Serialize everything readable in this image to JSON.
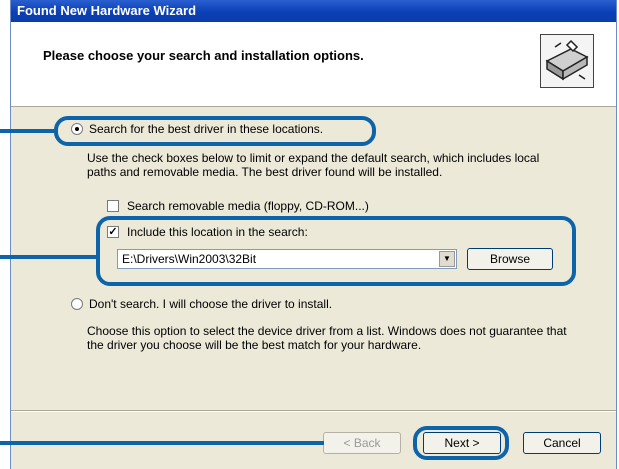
{
  "window": {
    "title": "Found New Hardware Wizard"
  },
  "header": {
    "title": "Please choose your search and installation options.",
    "icon": "hardware-icon"
  },
  "options": {
    "search_label": "Search for the best driver in these locations.",
    "search_desc_1": "Use the check boxes below to limit or expand the default search, which includes local",
    "search_desc_2": "paths and removable media. The best driver found will be installed.",
    "removable_label": "Search removable media (floppy, CD-ROM...)",
    "include_label": "Include this location in the search:",
    "location_value": "E:\\Drivers\\Win2003\\32Bit",
    "browse_label": "Browse",
    "dont_search_label": "Don't search. I will choose the driver to install.",
    "dont_desc_1": "Choose this option to select the device driver from a list.  Windows does not guarantee that",
    "dont_desc_2": "the driver you choose will be the best match for your hardware."
  },
  "footer": {
    "back_label": "< Back",
    "next_label": "Next >",
    "cancel_label": "Cancel"
  },
  "colors": {
    "highlight": "#0d64a8",
    "title_bar": "#0a3fb6"
  }
}
